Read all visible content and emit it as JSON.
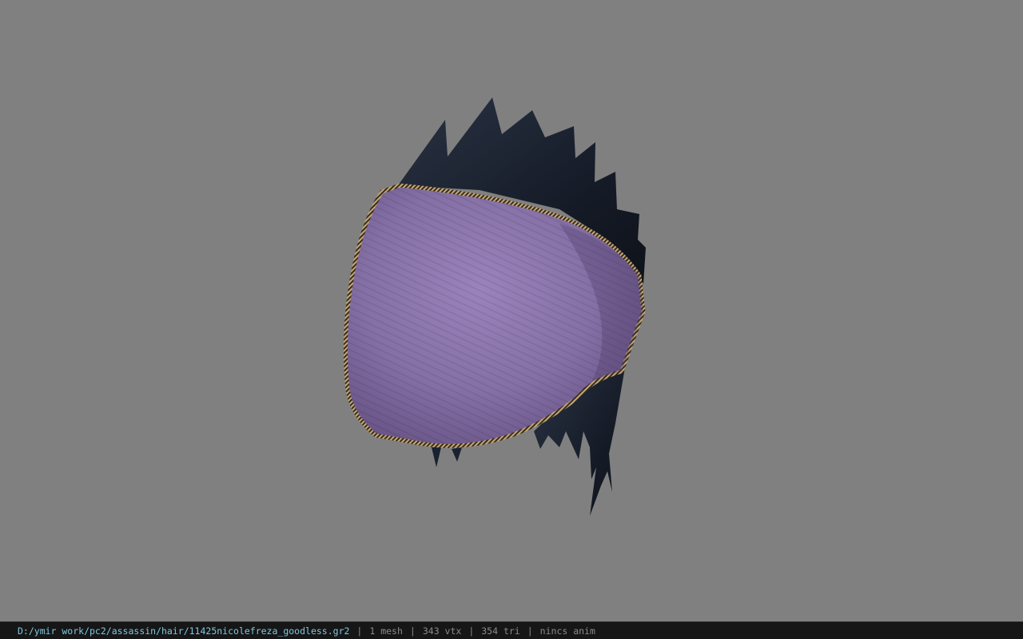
{
  "viewer": {
    "background_color": "#808080",
    "model_icon": "hair-model-icon",
    "model_colors": {
      "cap": "#8a72ab",
      "hair": "#1b2230",
      "trim": "#b49a6e"
    }
  },
  "status_bar": {
    "file_path": "D:/ymir work/pc2/assassin/hair/11425nicolefreza_goodless.gr2",
    "separator": "|",
    "mesh_count": "1 mesh",
    "vertex_count": "343 vtx",
    "triangle_count": "354 tri",
    "anim_status": "nincs anim"
  }
}
